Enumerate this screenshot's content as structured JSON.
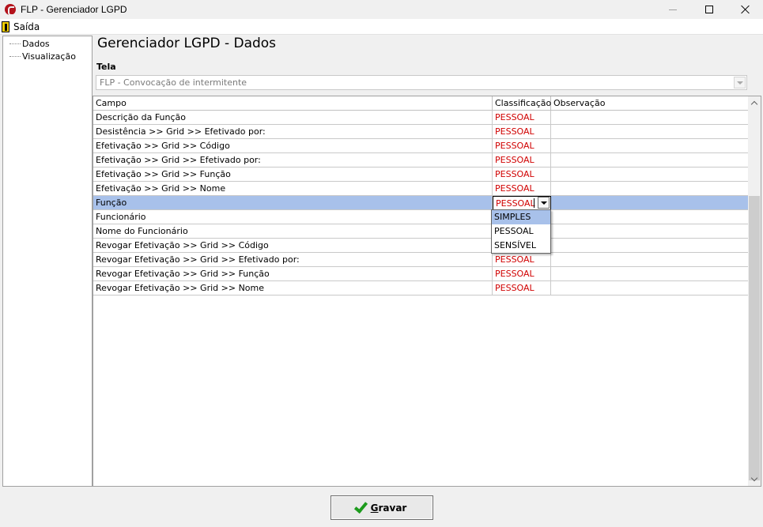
{
  "window": {
    "title": "FLP - Gerenciador LGPD"
  },
  "menu": {
    "exit_label": "Saída"
  },
  "tree": {
    "items": [
      {
        "label": "Dados"
      },
      {
        "label": "Visualização"
      }
    ]
  },
  "main": {
    "title": "Gerenciador LGPD - Dados",
    "tela_label": "Tela",
    "tela_value": "FLP - Convocação de intermitente"
  },
  "grid": {
    "columns": [
      "Campo",
      "Classificação",
      "Observação"
    ],
    "rows": [
      {
        "campo": "Descrição da Função",
        "classificacao": "PESSOAL",
        "observacao": ""
      },
      {
        "campo": "Desistência >> Grid >> Efetivado por:",
        "classificacao": "PESSOAL",
        "observacao": ""
      },
      {
        "campo": "Efetivação >> Grid >> Código",
        "classificacao": "PESSOAL",
        "observacao": ""
      },
      {
        "campo": "Efetivação >> Grid >> Efetivado por:",
        "classificacao": "PESSOAL",
        "observacao": ""
      },
      {
        "campo": "Efetivação >> Grid >> Função",
        "classificacao": "PESSOAL",
        "observacao": ""
      },
      {
        "campo": "Efetivação >> Grid >> Nome",
        "classificacao": "PESSOAL",
        "observacao": ""
      },
      {
        "campo": "Função",
        "classificacao": "PESSOAL",
        "observacao": ""
      },
      {
        "campo": "Funcionário",
        "classificacao": "",
        "observacao": ""
      },
      {
        "campo": "Nome do Funcionário",
        "classificacao": "",
        "observacao": ""
      },
      {
        "campo": "Revogar Efetivação >> Grid >> Código",
        "classificacao": "",
        "observacao": ""
      },
      {
        "campo": "Revogar Efetivação >> Grid >> Efetivado por:",
        "classificacao": "PESSOAL",
        "observacao": ""
      },
      {
        "campo": "Revogar Efetivação >> Grid >> Função",
        "classificacao": "PESSOAL",
        "observacao": ""
      },
      {
        "campo": "Revogar Efetivação >> Grid >> Nome",
        "classificacao": "PESSOAL",
        "observacao": ""
      }
    ]
  },
  "dropdown": {
    "options": [
      "SIMPLES",
      "PESSOAL",
      "SENSÍVEL"
    ],
    "highlighted": "SIMPLES"
  },
  "save_button": {
    "accel": "G",
    "rest": "ravar"
  },
  "colors": {
    "classification_text": "#d00000",
    "selection": "#a8c1ea",
    "app_icon": "#b3121b",
    "check": "#1d9b1d"
  }
}
